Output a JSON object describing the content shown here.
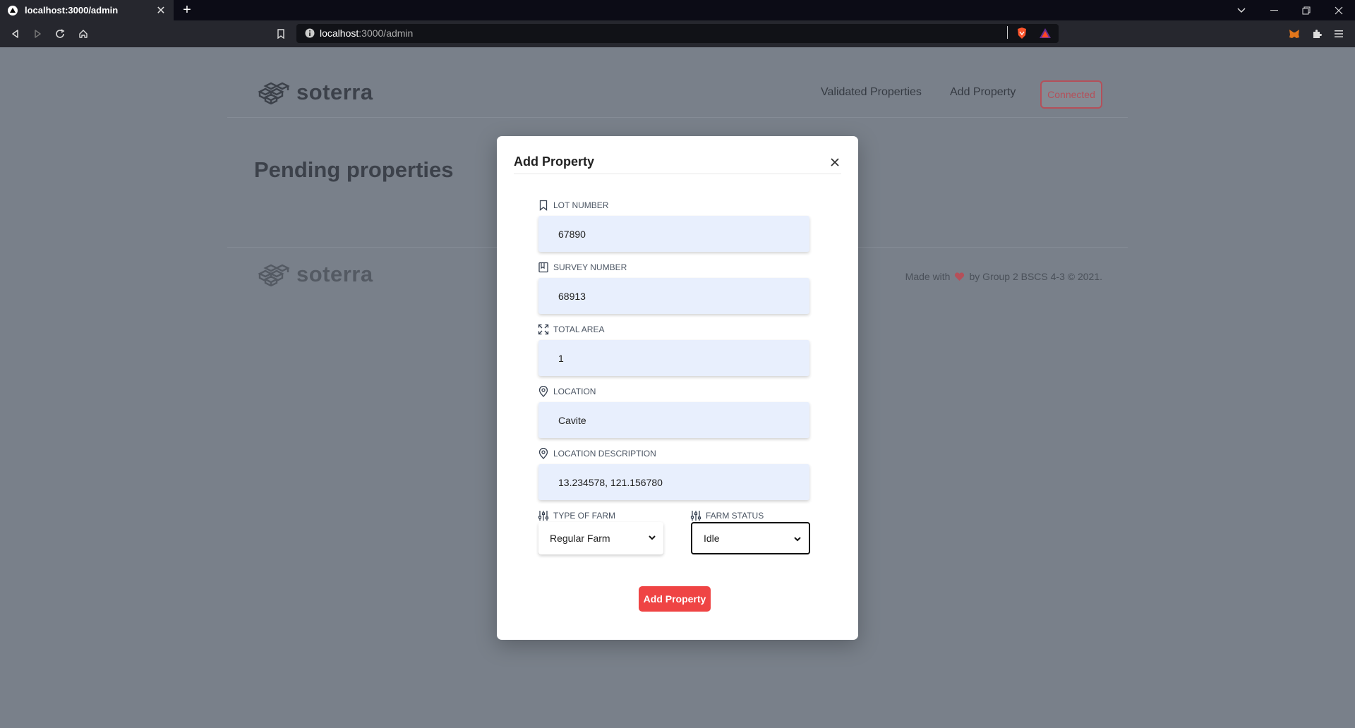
{
  "browser": {
    "tab_title": "localhost:3000/admin",
    "url_host": "localhost",
    "url_path": ":3000/admin"
  },
  "navbar": {
    "brand": "soterra",
    "links": [
      "Validated Properties",
      "Add Property"
    ],
    "connected_label": "Connected"
  },
  "main": {
    "title": "Pending properties"
  },
  "footer": {
    "brand": "soterra",
    "made_with": "Made with",
    "credit": "by Group 2 BSCS 4-3 © 2021."
  },
  "modal": {
    "title": "Add Property",
    "fields": {
      "lot_number": {
        "label": "LOT NUMBER",
        "value": "67890"
      },
      "survey_number": {
        "label": "SURVEY NUMBER",
        "value": "68913"
      },
      "total_area": {
        "label": "TOTAL AREA",
        "value": "1"
      },
      "location": {
        "label": "LOCATION",
        "value": "Cavite"
      },
      "location_description": {
        "label": "LOCATION DESCRIPTION",
        "value": "13.234578, 121.156780"
      }
    },
    "type_of_farm": {
      "label": "TYPE OF FARM",
      "value": "Regular Farm"
    },
    "farm_status": {
      "label": "FARM STATUS",
      "value": "Idle"
    },
    "submit_label": "Add Property"
  },
  "colors": {
    "accent": "#ef4444",
    "input_bg": "#e8effd",
    "overlay": "#79808a"
  }
}
